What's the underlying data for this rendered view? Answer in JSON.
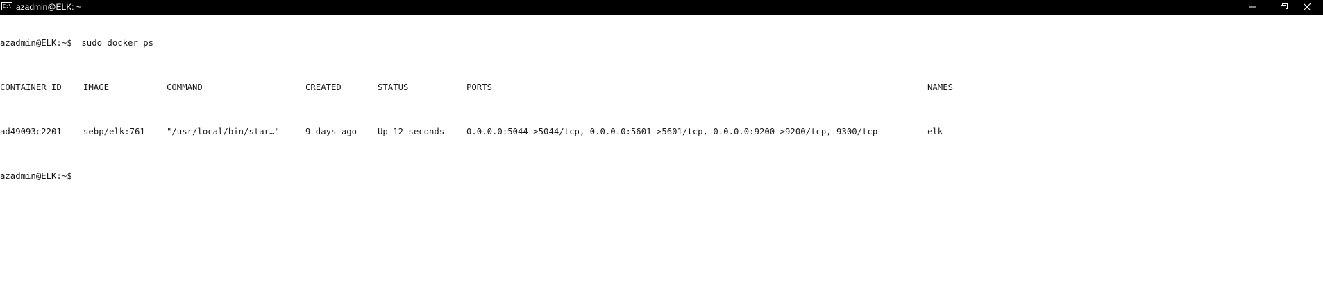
{
  "window": {
    "title": "azadmin@ELK: ~",
    "app_icon_text": "C:\\_",
    "controls": [
      "minimize-icon",
      "restore-icon",
      "close-icon"
    ]
  },
  "terminal": {
    "prompt_user": "azadmin@ELK:~$",
    "command": " sudo docker ps",
    "headers": {
      "container_id": "CONTAINER ID",
      "image": "IMAGE",
      "command": "COMMAND",
      "created": "CREATED",
      "status": "STATUS",
      "ports": "PORTS",
      "names": "NAMES"
    },
    "rows": [
      {
        "container_id": "ad49093c2201",
        "image": "sebp/elk:761",
        "command": "\"/usr/local/bin/star…\"",
        "created": "9 days ago",
        "status": "Up 12 seconds",
        "ports": "0.0.0.0:5044->5044/tcp, 0.0.0.0:5601->5601/tcp, 0.0.0.0:9200->9200/tcp, 9300/tcp",
        "names": "elk"
      }
    ],
    "final_prompt": "azadmin@ELK:~$"
  }
}
